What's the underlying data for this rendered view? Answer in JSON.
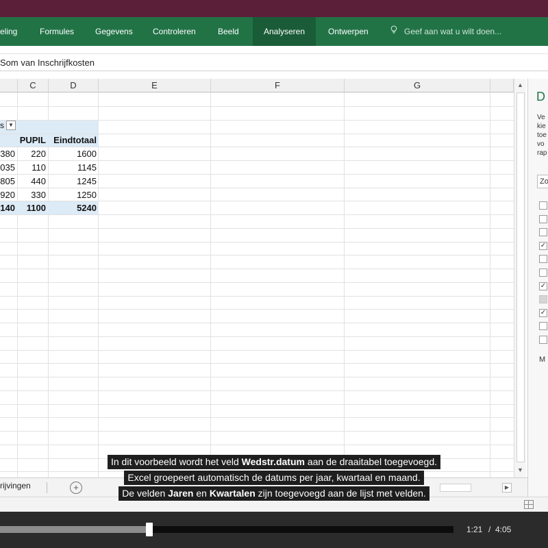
{
  "ribbon": {
    "tabs": [
      {
        "label": "eling",
        "active": false
      },
      {
        "label": "Formules",
        "active": false
      },
      {
        "label": "Gegevens",
        "active": false
      },
      {
        "label": "Controleren",
        "active": false
      },
      {
        "label": "Beeld",
        "active": false
      },
      {
        "label": "Analyseren",
        "active": true
      },
      {
        "label": "Ontwerpen",
        "active": false
      }
    ],
    "tell_me": "Geef aan wat u wilt doen...",
    "tell_me_icon": "lightbulb-icon"
  },
  "formula_bar": {
    "text": "Som van Inschrijfkosten"
  },
  "grid": {
    "columns": [
      "C",
      "D",
      "E",
      "F",
      "G"
    ],
    "pivot": {
      "header": {
        "c": "PUPIL",
        "d": "Eindtotaal"
      },
      "rows": [
        {
          "b": "380",
          "c": "220",
          "d": "1600"
        },
        {
          "b": "035",
          "c": "110",
          "d": "1145"
        },
        {
          "b": "805",
          "c": "440",
          "d": "1245"
        },
        {
          "b": "920",
          "c": "330",
          "d": "1250"
        }
      ],
      "total": {
        "b": "140",
        "c": "1100",
        "d": "5240"
      },
      "label_fragment": "s"
    }
  },
  "pane": {
    "title": "D",
    "desc": [
      "Ve",
      "kie",
      "toe",
      "vo",
      "rap"
    ],
    "search": "Zo",
    "checkboxes": [
      {
        "checked": false,
        "highlight": false
      },
      {
        "checked": false,
        "highlight": false
      },
      {
        "checked": false,
        "highlight": false
      },
      {
        "checked": true,
        "highlight": false
      },
      {
        "checked": false,
        "highlight": false
      },
      {
        "checked": false,
        "highlight": false
      },
      {
        "checked": true,
        "highlight": false
      },
      {
        "checked": false,
        "highlight": true
      },
      {
        "checked": true,
        "highlight": false
      },
      {
        "checked": false,
        "highlight": false
      },
      {
        "checked": false,
        "highlight": false
      }
    ],
    "footer": "M"
  },
  "sheet_tabs": {
    "active": "rijvingen",
    "add_label": "+"
  },
  "subtitles": {
    "line1": {
      "pre": "In dit voorbeeld wordt het veld ",
      "bold": "Wedstr.datum",
      "post": " aan de draaitabel toegevoegd."
    },
    "line2": "Excel groepeert automatisch de datums per jaar, kwartaal en maand.",
    "line3": {
      "pre": "De velden ",
      "bold1": "Jaren",
      "mid": " en ",
      "bold2": "Kwartalen",
      "post": " zijn toegevoegd aan de lijst met velden."
    }
  },
  "video": {
    "current_time": "1:21",
    "separator": "/",
    "duration": "4:05",
    "progress_fraction": 0.33
  },
  "colors": {
    "title_bar": "#5b1f3a",
    "ribbon": "#217346",
    "pivot_highlight": "#ddebf7"
  }
}
